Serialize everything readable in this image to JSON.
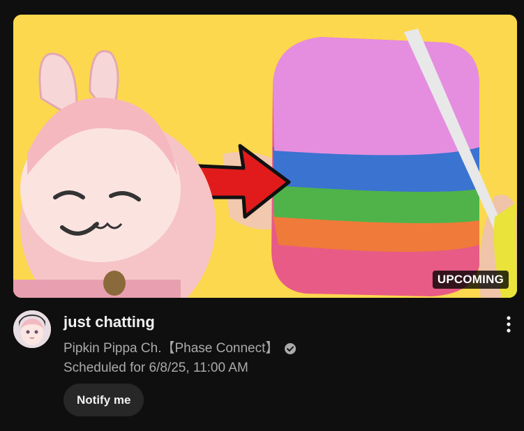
{
  "video": {
    "badge": "UPCOMING",
    "title": "just chatting",
    "channel": "Pipkin Pippa Ch.【Phase Connect】",
    "scheduled": "Scheduled for 6/8/25, 11:00 AM",
    "notify_label": "Notify me"
  },
  "icons": {
    "verified": "verified-check-icon",
    "menu": "more-vert-icon"
  },
  "colors": {
    "background": "#0f0f0f",
    "thumbnail_bg": "#fcd84e",
    "secondary_text": "#aaaaaa",
    "button_bg": "#272727"
  }
}
